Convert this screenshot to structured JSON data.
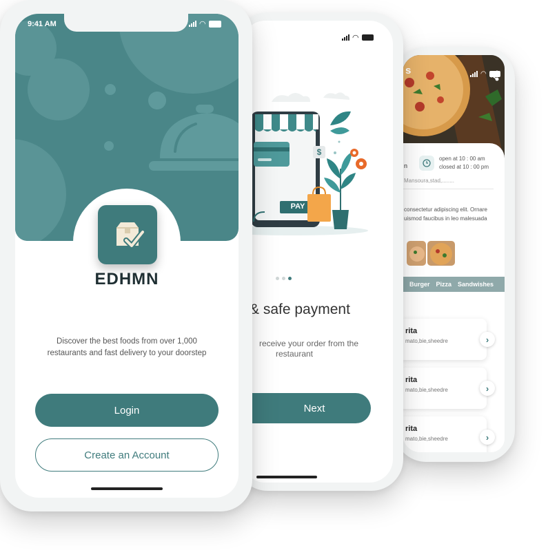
{
  "colors": {
    "accent": "#3f7b7c",
    "header": "#4a8688",
    "orange": "#f3a64a"
  },
  "phone1": {
    "time": "9:41 AM",
    "app_name": "EDHMN",
    "description_line1": "Discover the best foods from over 1,000",
    "description_line2": "restaurants and fast delivery to your doorstep",
    "login_label": "Login",
    "create_label": "Create an Account"
  },
  "phone2": {
    "pay_label": "PAY",
    "dollar_sign": "$",
    "title": "& safe payment",
    "desc_line1": "receive your order from the",
    "desc_line2": "restaurant",
    "next_label": "Next",
    "page_dots": {
      "count": 3,
      "active": 3
    }
  },
  "phone3": {
    "header_letter": "s",
    "open_time": "open at 10 : 00 am",
    "closed_time": "closed at 10 : 00 pm",
    "n_letter": "n",
    "address": "Mansoura,stad,........",
    "about_line1": "consectetur adipiscing elit. Ornare",
    "about_line2": "uismod faucibus in leo malesuada",
    "categories": [
      "Burger",
      "Pizza",
      "Sandwishes"
    ],
    "items": [
      {
        "name": "rita",
        "desc": "mato,bie,sheedre"
      },
      {
        "name": "rita",
        "desc": "mato,bie,sheedre"
      },
      {
        "name": "rita",
        "desc": "mato,bie,sheedre"
      }
    ]
  }
}
